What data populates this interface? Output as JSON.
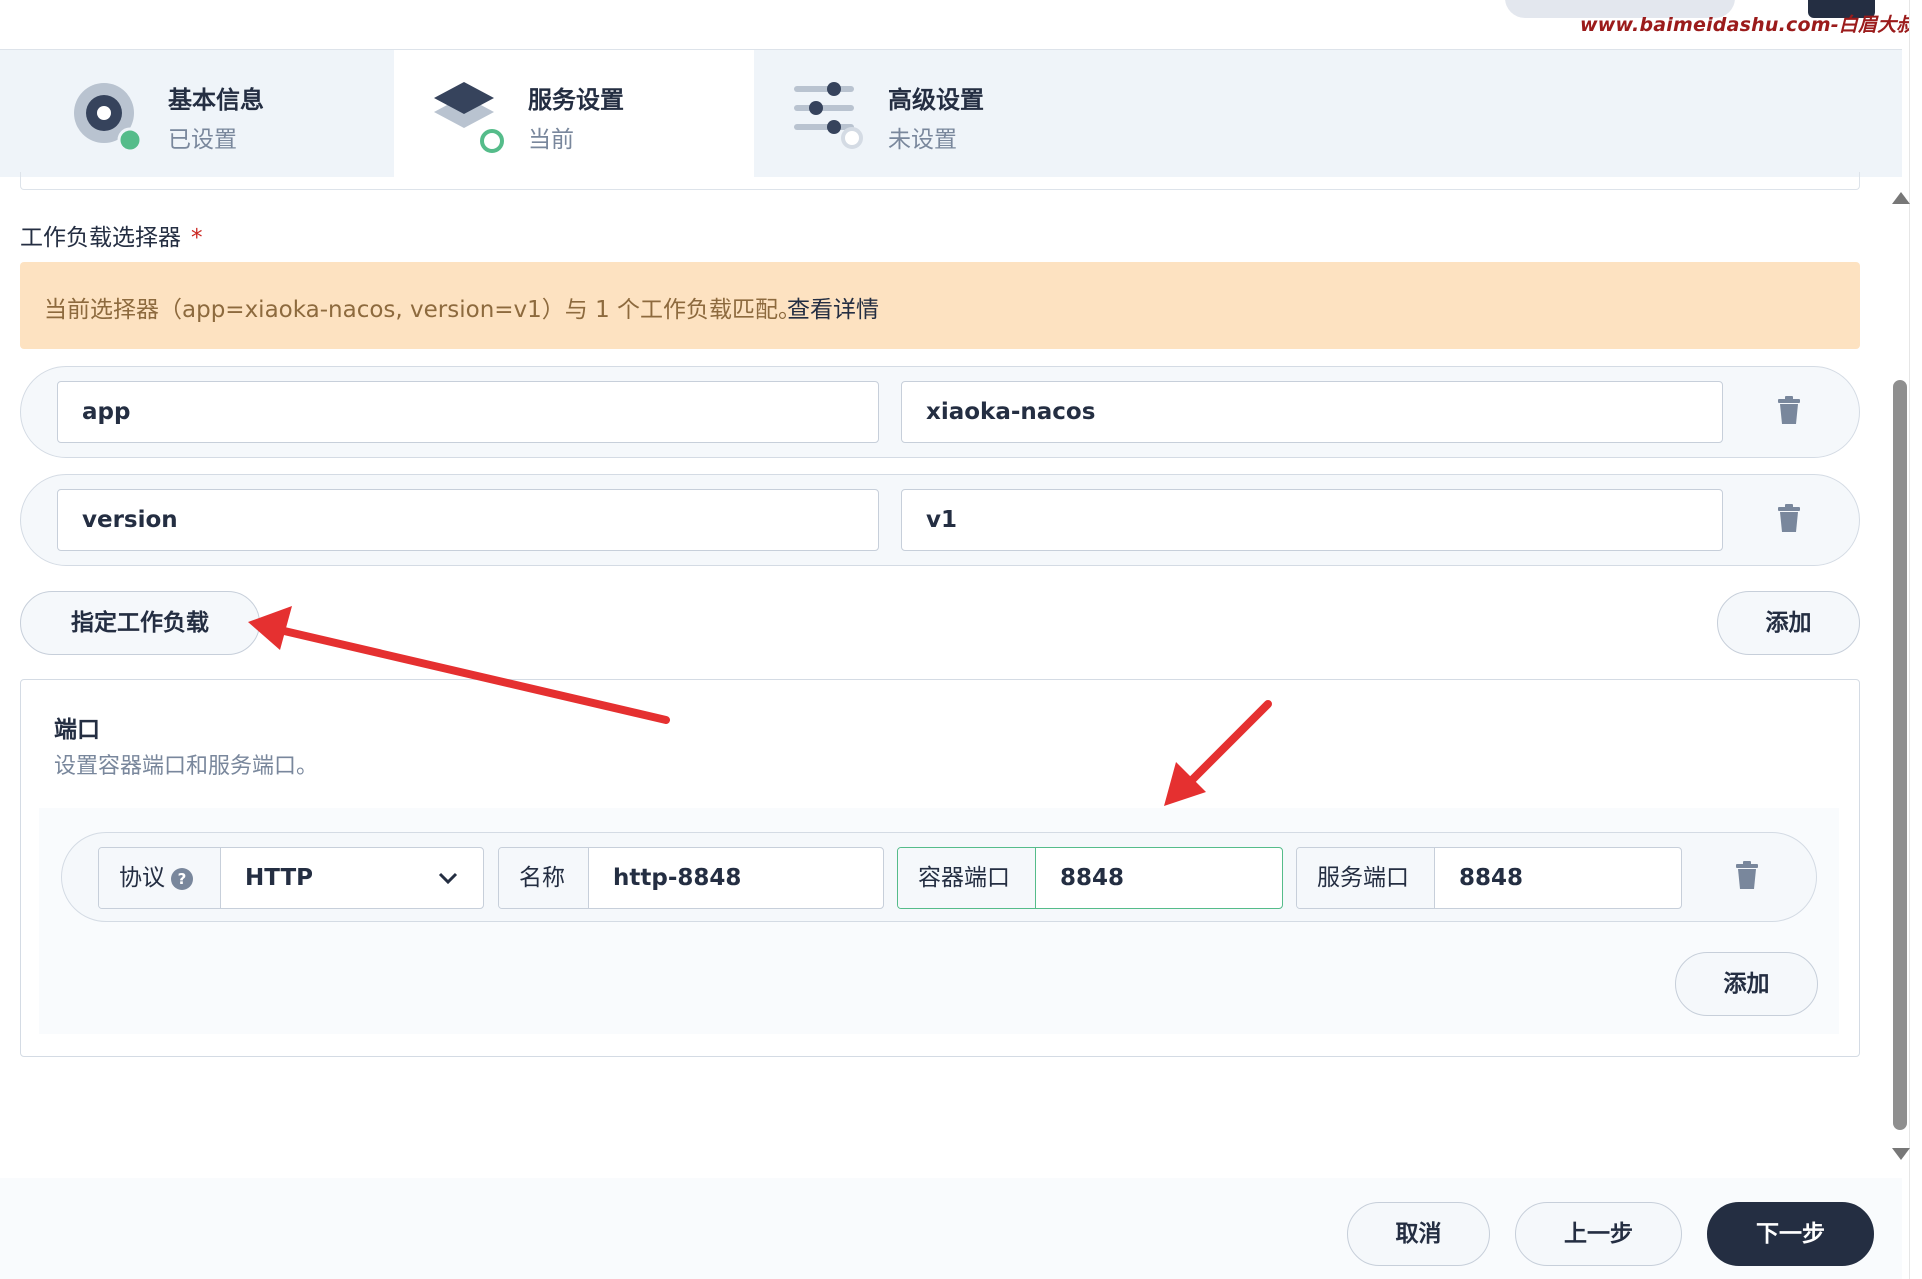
{
  "watermark": "www.baimeidashu.com-白眉大叔",
  "steps": [
    {
      "title": "基本信息",
      "status": "已设置"
    },
    {
      "title": "服务设置",
      "status": "当前"
    },
    {
      "title": "高级设置",
      "status": "未设置"
    }
  ],
  "selector": {
    "label": "工作负载选择器",
    "required_mark": "*",
    "alert_message": "当前选择器（app=xiaoka-nacos, version=v1）与 1 个工作负载匹配。",
    "alert_link": "查看详情",
    "rows": [
      {
        "key": "app",
        "value": "xiaoka-nacos"
      },
      {
        "key": "version",
        "value": "v1"
      }
    ],
    "specify_workload_label": "指定工作负载",
    "add_label": "添加"
  },
  "ports": {
    "title": "端口",
    "description": "设置容器端口和服务端口。",
    "rows": [
      {
        "protocol_label": "协议",
        "protocol_help": "?",
        "protocol_value": "HTTP",
        "name_label": "名称",
        "name_value": "http-8848",
        "container_port_label": "容器端口",
        "container_port_value": "8848",
        "service_port_label": "服务端口",
        "service_port_value": "8848"
      }
    ],
    "add_label": "添加"
  },
  "footer": {
    "cancel_label": "取消",
    "prev_label": "上一步",
    "next_label": "下一步"
  },
  "colors": {
    "primary_dark": "#242e42",
    "success_green": "#55bc8a",
    "alert_bg": "#fde2c1",
    "annotation_red": "#e53030"
  }
}
